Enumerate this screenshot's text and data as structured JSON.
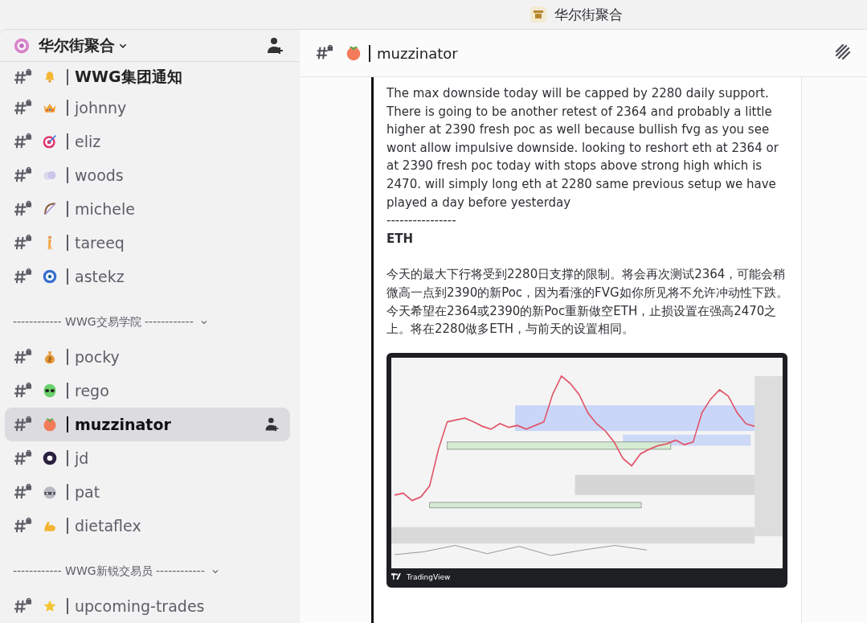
{
  "window": {
    "title": "华尔街聚合"
  },
  "server": {
    "name": "华尔街聚合"
  },
  "sidebar": {
    "items": [
      {
        "kind": "channel",
        "name": "WWG集团通知",
        "selected": false,
        "bold": true
      },
      {
        "kind": "channel",
        "name": "johnny",
        "selected": false
      },
      {
        "kind": "channel",
        "name": "eliz",
        "selected": false
      },
      {
        "kind": "channel",
        "name": "woods",
        "selected": false
      },
      {
        "kind": "channel",
        "name": "michele",
        "selected": false
      },
      {
        "kind": "channel",
        "name": "tareeq",
        "selected": false
      },
      {
        "kind": "channel",
        "name": "astekz",
        "selected": false
      },
      {
        "kind": "category",
        "name": "------------ WWG交易学院 ------------"
      },
      {
        "kind": "channel",
        "name": "pocky",
        "selected": false
      },
      {
        "kind": "channel",
        "name": "rego",
        "selected": false
      },
      {
        "kind": "channel",
        "name": "muzzinator",
        "selected": true
      },
      {
        "kind": "channel",
        "name": "jd",
        "selected": false
      },
      {
        "kind": "channel",
        "name": "pat",
        "selected": false
      },
      {
        "kind": "channel",
        "name": "dietaflex",
        "selected": false
      },
      {
        "kind": "category",
        "name": "------------ WWG新锐交易员 ------------"
      },
      {
        "kind": "channel",
        "name": "upcoming-trades",
        "selected": false
      }
    ]
  },
  "channel_header": {
    "name": "muzzinator"
  },
  "message": {
    "paragraphs": [
      {
        "kind": "text",
        "text": "The max downside today will be capped by 2280 daily support. There is going to be another retest of 2364 and probably a little higher at 2390 fresh poc as well because bullish fvg as you see wont allow impulsive downside. looking to reshort eth at 2364 or at 2390 fresh poc today with stops above strong high which is 2470. will simply long eth at 2280 same previous setup we have played a day before yesterday"
      },
      {
        "kind": "text",
        "text": "----------------"
      },
      {
        "kind": "heading",
        "text": "ETH"
      },
      {
        "kind": "text",
        "text": "今天的最大下行将受到2280日支撑的限制。将会再次测试2364，可能会稍微高一点到2390的新Poc，因为看涨的FVG如你所见将不允许冲动性下跌。今天希望在2364或2390的新Poc重新做空ETH，止损设置在强高2470之上。将在2280做多ETH，与前天的设置相同。"
      }
    ],
    "attachment": {
      "footer": "TradingView"
    }
  }
}
